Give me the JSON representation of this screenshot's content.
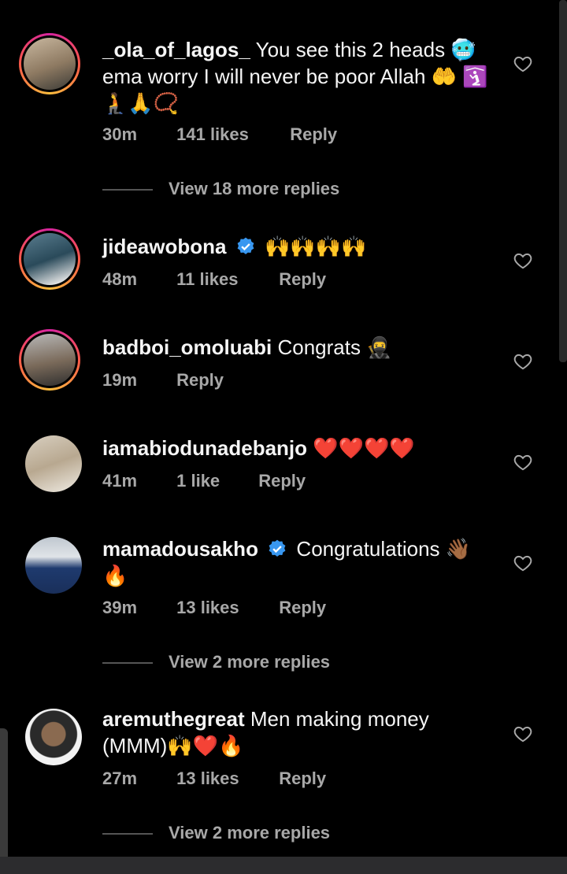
{
  "comments": [
    {
      "username": "_ola_of_lagos_",
      "verified": false,
      "text": "You see this 2 heads 🥶 ema worry I will never be poor Allah 🤲 🛐🧎🙏📿",
      "time": "30m",
      "likes": "141 likes",
      "reply": "Reply",
      "more_replies": "View 18 more replies"
    },
    {
      "username": "jideawobona",
      "verified": true,
      "text": "🙌🙌🙌🙌",
      "time": "48m",
      "likes": "11 likes",
      "reply": "Reply"
    },
    {
      "username": "badboi_omoluabi",
      "verified": false,
      "text": "Congrats 🥷",
      "time": "19m",
      "reply": "Reply"
    },
    {
      "username": "iamabiodunadebanjo",
      "verified": false,
      "text": "❤️❤️❤️❤️",
      "time": "41m",
      "likes": "1 like",
      "reply": "Reply"
    },
    {
      "username": "mamadousakho",
      "verified": true,
      "text": "Congratulations 👋🏾 🔥",
      "time": "39m",
      "likes": "13 likes",
      "reply": "Reply",
      "more_replies": "View 2 more replies"
    },
    {
      "username": "aremuthegreat",
      "verified": false,
      "text": "Men making money (MMM)🙌❤️🔥",
      "time": "27m",
      "likes": "13 likes",
      "reply": "Reply",
      "more_replies": "View 2 more replies"
    }
  ],
  "colors": {
    "background": "#000000",
    "text": "#f5f5f5",
    "meta": "#a8a8a8",
    "verified": "#3897f0",
    "story_ring": "#d6249f"
  }
}
